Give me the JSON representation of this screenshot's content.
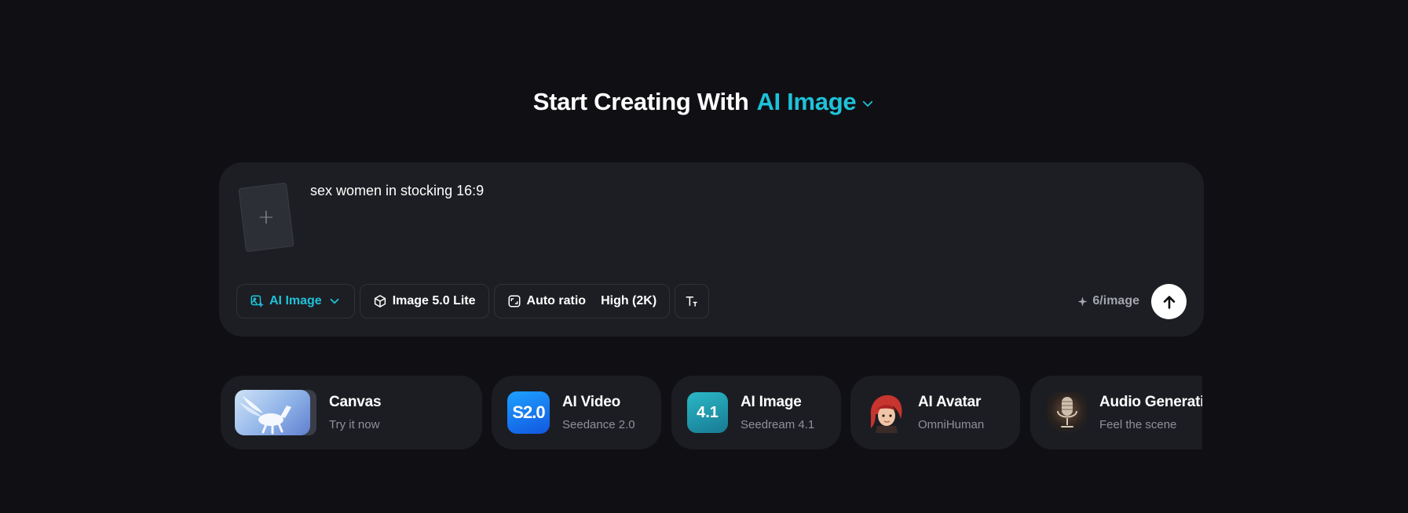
{
  "header": {
    "title_prefix": "Start Creating With",
    "mode_label": "AI Image"
  },
  "composer": {
    "prompt_value": "sex women in stocking 16:9",
    "upload_glyph": "+",
    "toolbar": {
      "mode_chip": "AI Image",
      "model_chip": "Image 5.0 Lite",
      "ratio_chip": "Auto ratio",
      "quality_chip": "High (2K)",
      "text_icon": "text-size-icon"
    },
    "cost_label": "6/image",
    "send_icon": "arrow-up-icon"
  },
  "tools": [
    {
      "title": "Canvas",
      "subtitle": "Try it now"
    },
    {
      "title": "AI Video",
      "subtitle": "Seedance 2.0",
      "badge": "S2.0"
    },
    {
      "title": "AI Image",
      "subtitle": "Seedream 4.1",
      "badge": "4.1"
    },
    {
      "title": "AI Avatar",
      "subtitle": "OmniHuman"
    },
    {
      "title": "Audio Generation",
      "subtitle": "Feel the scene"
    }
  ],
  "colors": {
    "background": "#101014",
    "panel": "#1d1e23",
    "accent": "#1ec2d9"
  }
}
